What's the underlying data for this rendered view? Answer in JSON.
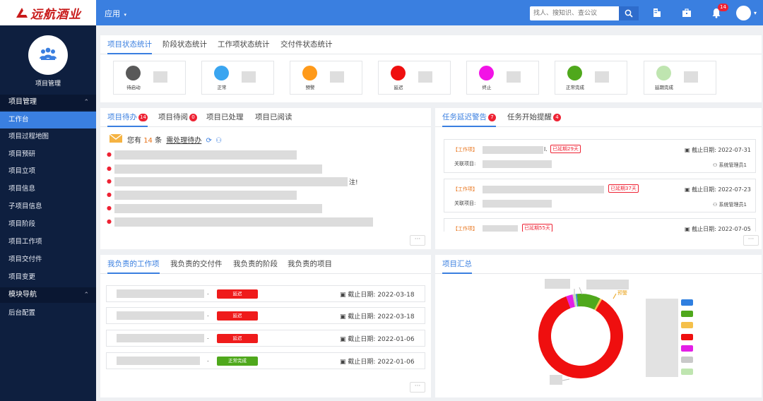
{
  "header": {
    "logo_text": "远航酒业",
    "app_menu_label": "应用",
    "search_placeholder": "找人、搜知识、查公议",
    "notification_count": "14"
  },
  "sidebar": {
    "project_label": "项目管理",
    "groups": [
      {
        "label": "项目管理",
        "items": [
          "工作台",
          "项目过程地图",
          "项目预研",
          "项目立项",
          "项目信息",
          "子项目信息",
          "项目阶段",
          "项目工作项",
          "项目交付件",
          "项目变更"
        ]
      },
      {
        "label": "模块导航",
        "items": [
          "后台配置"
        ]
      }
    ]
  },
  "status_card": {
    "tabs": [
      "项目状态统计",
      "阶段状态统计",
      "工作项状态统计",
      "交付件状态统计"
    ],
    "stats": [
      {
        "label": "待启动",
        "color": "#595959"
      },
      {
        "label": "正常",
        "color": "#3aa5f0"
      },
      {
        "label": "预警",
        "color": "#ff9a1a"
      },
      {
        "label": "延迟",
        "color": "#ef0f0f"
      },
      {
        "label": "终止",
        "color": "#f213e6"
      },
      {
        "label": "正常完成",
        "color": "#4fa81c"
      },
      {
        "label": "延期完成",
        "color": "#bfe5b0"
      }
    ]
  },
  "todo_card": {
    "tabs": [
      {
        "label": "项目待办",
        "badge": "14"
      },
      {
        "label": "项目待阅",
        "badge": "0"
      },
      {
        "label": "项目已处理",
        "badge": ""
      },
      {
        "label": "项目已阅读",
        "badge": ""
      }
    ],
    "summary_prefix": "您有",
    "summary_count": "14",
    "summary_unit": "条",
    "summary_link": "需处理待办",
    "item_tail": "注!",
    "more": "···"
  },
  "warning_card": {
    "tabs": [
      {
        "label": "任务延迟警告",
        "badge": "7"
      },
      {
        "label": "任务开始提醒",
        "badge": "4"
      }
    ],
    "items": [
      {
        "tag": "【工作项】",
        "name_tail": "l.",
        "delay": "已延期29天",
        "due_label": "截止日期:",
        "due": "2022-07-31",
        "project_label": "关联项目:",
        "user": "系统管理员1"
      },
      {
        "tag": "【工作项】",
        "name_tail": "",
        "delay": "已延期37天",
        "due_label": "截止日期:",
        "due": "2022-07-23",
        "project_label": "关联项目:",
        "user": "系统管理员1"
      },
      {
        "tag": "【工作项】",
        "name_tail": "",
        "delay": "已延期55天",
        "due_label": "截止日期:",
        "due": "2022-07-05",
        "project_label": "",
        "user": ""
      }
    ],
    "more": "···"
  },
  "work_card": {
    "tabs": [
      "我负责的工作项",
      "我负责的交付件",
      "我负责的阶段",
      "我负责的项目"
    ],
    "rows": [
      {
        "tail": ".",
        "status": "延迟",
        "status_color": "#ef1b1b",
        "due_label": "截止日期:",
        "due": "2022-03-18"
      },
      {
        "tail": ".",
        "status": "延迟",
        "status_color": "#ef1b1b",
        "due_label": "截止日期:",
        "due": "2022-03-18"
      },
      {
        "tail": ".",
        "status": "延迟",
        "status_color": "#ef1b1b",
        "due_label": "截止日期:",
        "due": "2022-01-06"
      },
      {
        "tail": ".",
        "status": "正常完成",
        "status_color": "#4fa81c",
        "due_label": "截止日期:",
        "due": "2022-01-06"
      }
    ],
    "more": "···"
  },
  "summary_card": {
    "tab": "项目汇总",
    "chart_label": "预警"
  },
  "chart_data": {
    "type": "pie",
    "title": "",
    "slices": [
      {
        "name": "正常",
        "value": 0.5,
        "color": "#2f7fe0"
      },
      {
        "name": "正常完成",
        "value": 9,
        "color": "#4fa81c"
      },
      {
        "name": "预警",
        "value": 0.8,
        "color": "#f5c04a"
      },
      {
        "name": "延迟",
        "value": 86,
        "color": "#ef0f0f"
      },
      {
        "name": "终止",
        "value": 2.5,
        "color": "#e31fe6"
      },
      {
        "name": "待启动",
        "value": 0.6,
        "color": "#c9c9c9"
      },
      {
        "name": "延期完成",
        "value": 0.6,
        "color": "#bfe5b0"
      }
    ],
    "legend_position": "right"
  }
}
